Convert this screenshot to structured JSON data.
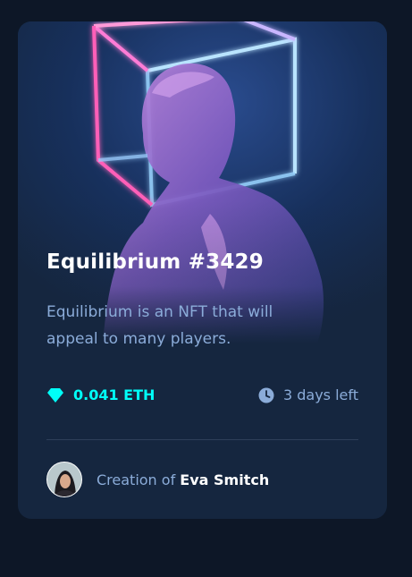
{
  "card": {
    "title": "Equilibrium #3429",
    "description": "Equilibrium is an NFT that will appeal to many players.",
    "price": "0.041 ETH",
    "time_left": "3 days left",
    "creator_prefix": "Creation of",
    "creator_name": "Eva Smitch"
  },
  "icons": {
    "price": "ethereum-icon",
    "time": "clock-icon"
  },
  "colors": {
    "background": "#0d1727",
    "card": "#15263f",
    "accent": "#00fff8",
    "muted": "#8bacd9",
    "divider": "#2e405a"
  }
}
